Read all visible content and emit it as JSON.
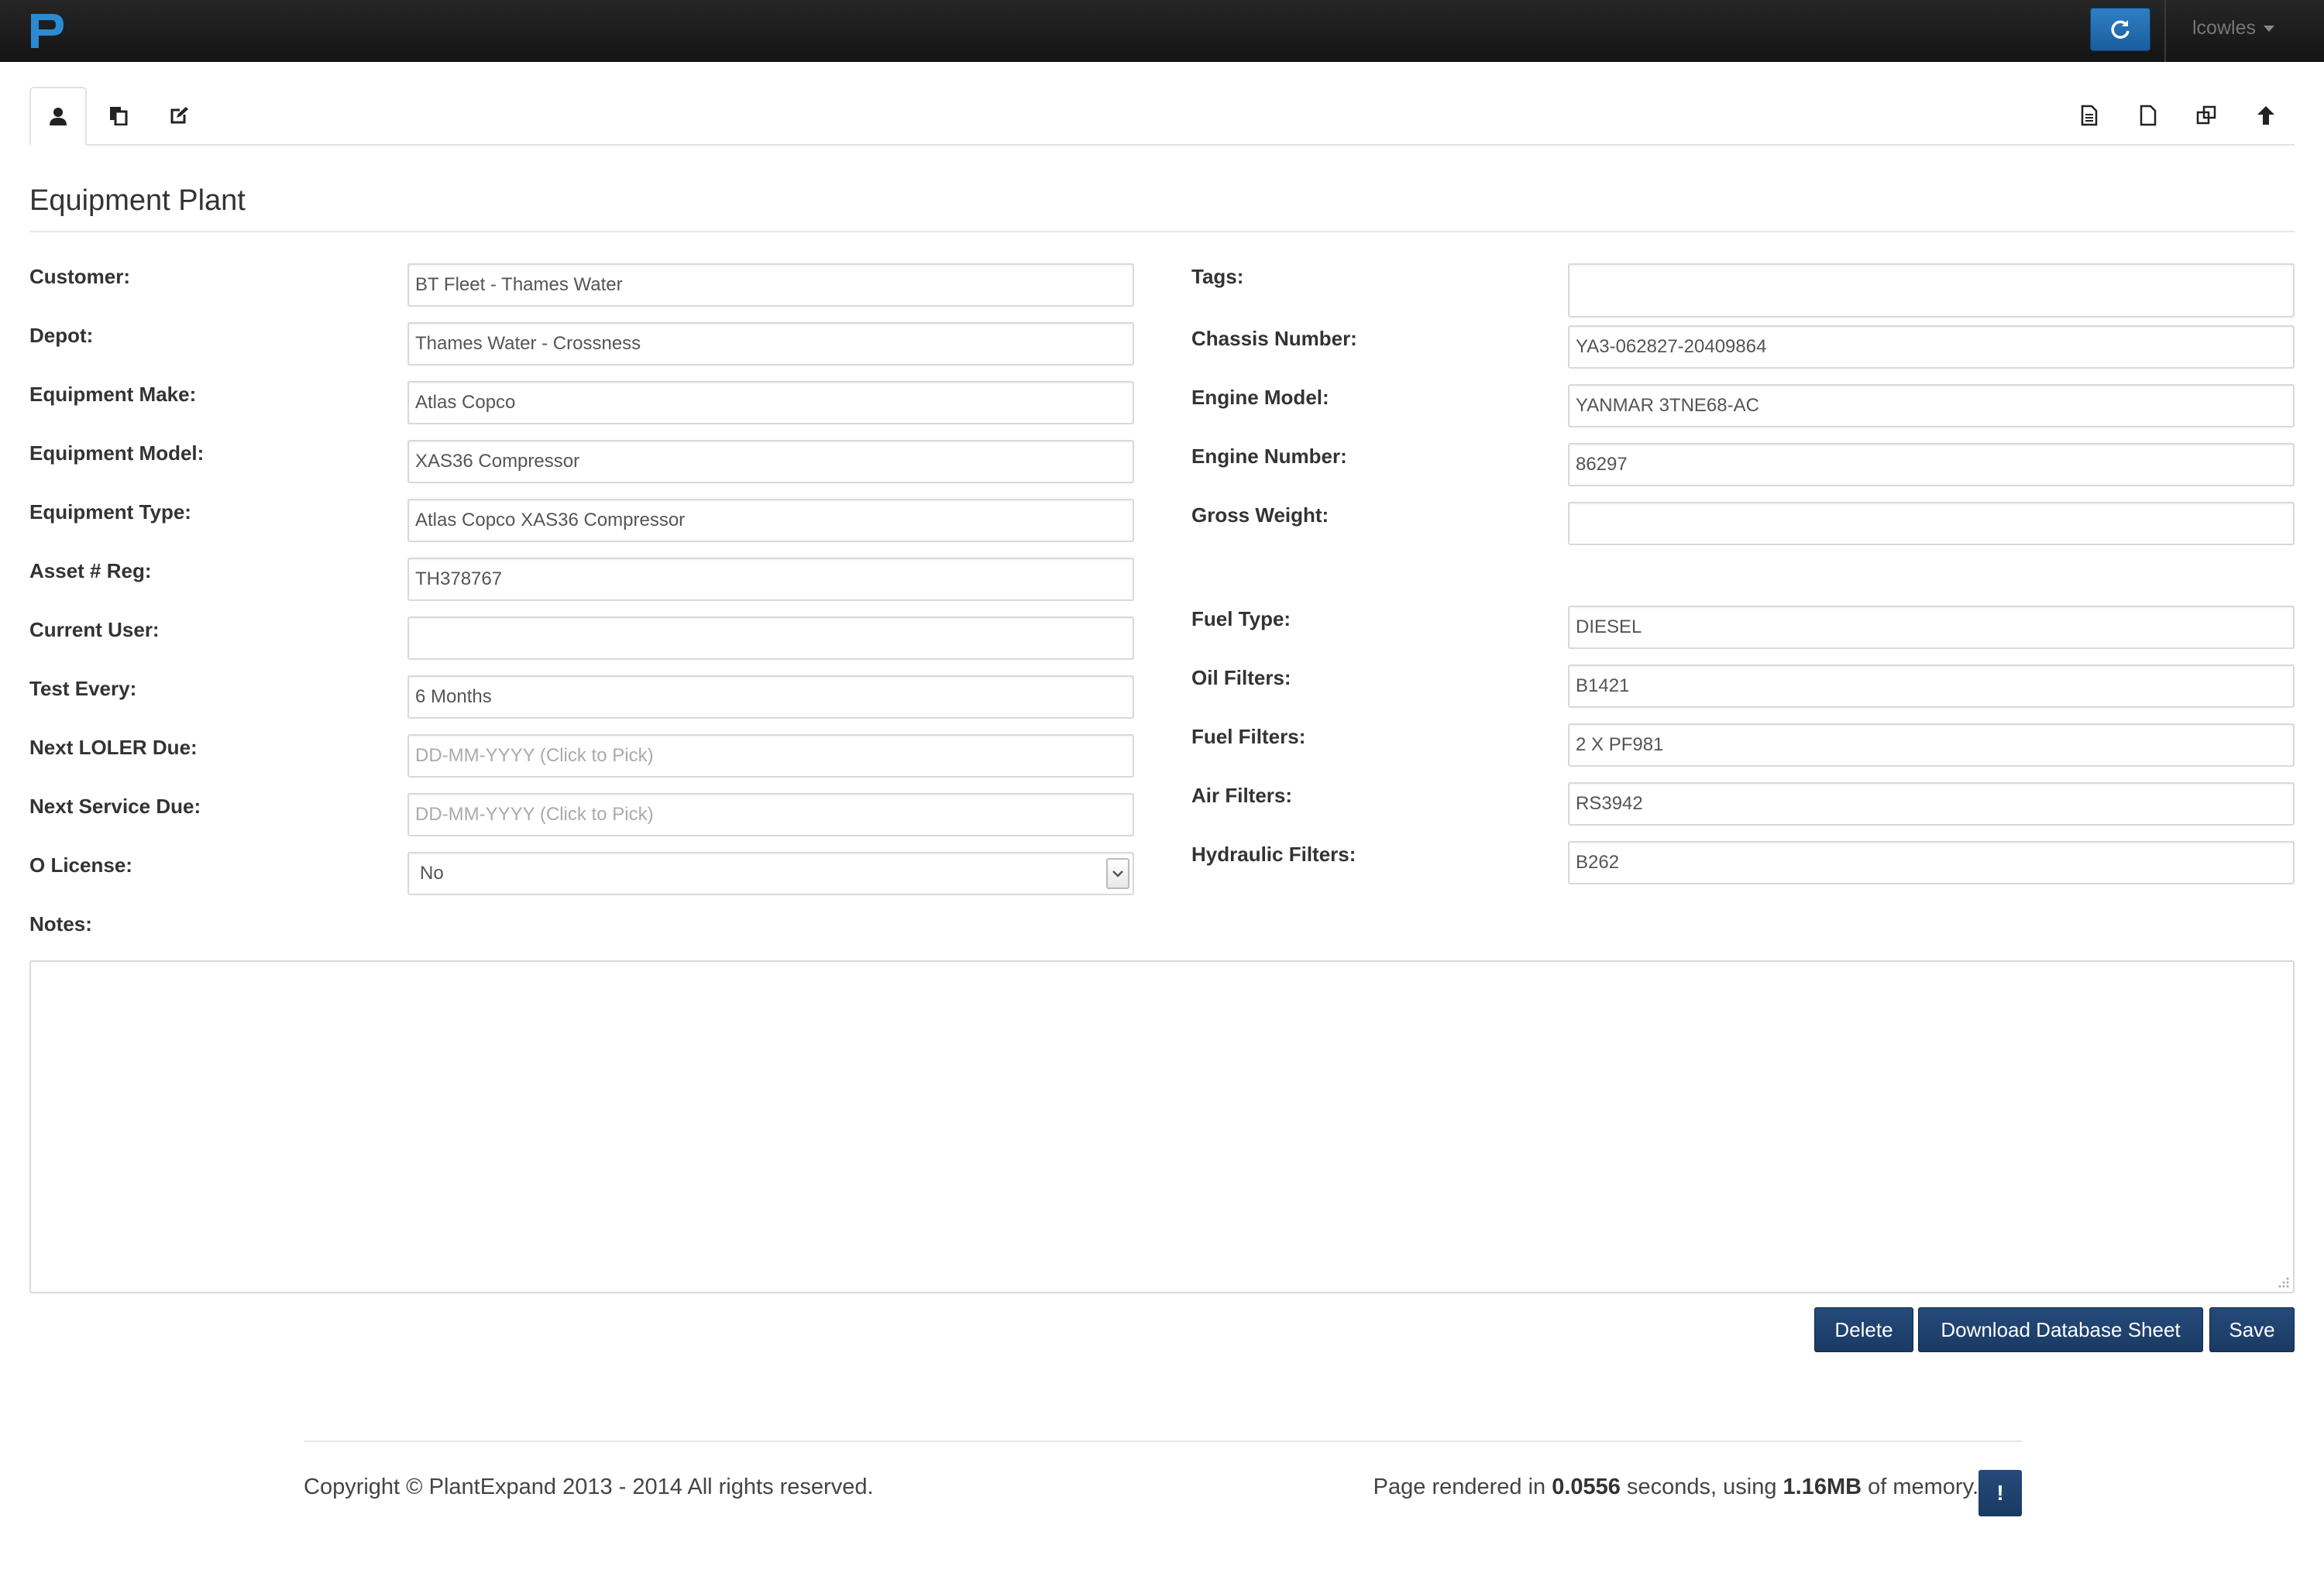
{
  "app": {
    "logo_letter": "P",
    "user": "lcowles",
    "accent_color": "#1f4e83",
    "logo_color": "#2a8bd2"
  },
  "toolbar": {
    "tabs": [
      {
        "icon": "user-icon",
        "active": true
      },
      {
        "icon": "copy-icon",
        "active": false
      },
      {
        "icon": "edit-icon",
        "active": false
      }
    ],
    "tools": [
      "document-text-icon",
      "document-icon",
      "duplicate-icon",
      "arrow-up-icon"
    ]
  },
  "page": {
    "title": "Equipment Plant"
  },
  "form": {
    "left": [
      {
        "label": "Customer:",
        "value": "BT Fleet - Thames Water"
      },
      {
        "label": "Depot:",
        "value": "Thames Water - Crossness"
      },
      {
        "label": "Equipment Make:",
        "value": "Atlas Copco"
      },
      {
        "label": "Equipment Model:",
        "value": "XAS36 Compressor"
      },
      {
        "label": "Equipment Type:",
        "value": "Atlas Copco XAS36 Compressor"
      },
      {
        "label": "Asset # Reg:",
        "value": "TH378767"
      },
      {
        "label": "Current User:",
        "value": ""
      },
      {
        "label": "Test Every:",
        "value": "6 Months"
      },
      {
        "label": "Next LOLER Due:",
        "value": "",
        "placeholder": "DD-MM-YYYY (Click to Pick)"
      },
      {
        "label": "Next Service Due:",
        "value": "",
        "placeholder": "DD-MM-YYYY (Click to Pick)"
      },
      {
        "label": "O License:",
        "value": "No"
      }
    ],
    "right": [
      {
        "label": "Tags:",
        "value": ""
      },
      {
        "label": "Chassis Number:",
        "value": "YA3-062827-20409864"
      },
      {
        "label": "Engine Model:",
        "value": "YANMAR 3TNE68-AC"
      },
      {
        "label": "Engine Number:",
        "value": "86297"
      },
      {
        "label": "Gross Weight:",
        "value": ""
      },
      {
        "label": "Fuel Type:",
        "value": "DIESEL"
      },
      {
        "label": "Oil Filters:",
        "value": "B1421"
      },
      {
        "label": "Fuel Filters:",
        "value": "2 X PF981"
      },
      {
        "label": "Air Filters:",
        "value": "RS3942"
      },
      {
        "label": "Hydraulic Filters:",
        "value": "B262"
      }
    ],
    "notes_label": "Notes:",
    "notes_value": ""
  },
  "actions": {
    "delete": "Delete",
    "download": "Download Database Sheet",
    "save": "Save"
  },
  "footer": {
    "copyright": "Copyright © PlantExpand 2013 - 2014 All rights reserved.",
    "render_prefix": "Page rendered in ",
    "render_time": "0.0556",
    "render_mid": " seconds, using ",
    "render_memory": "1.16MB",
    "render_suffix": " of memory.",
    "info_button": "!"
  }
}
